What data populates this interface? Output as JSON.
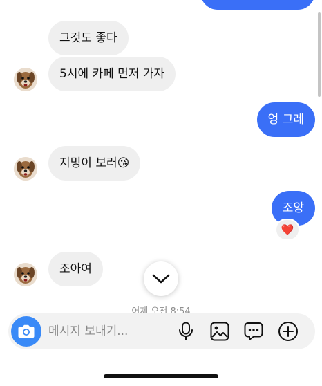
{
  "messages": [
    {
      "text": "그것도 좋다",
      "direction": "incoming"
    },
    {
      "text": "5시에 카페 먼저 가자",
      "direction": "incoming"
    },
    {
      "text": "엉 그레",
      "direction": "outgoing"
    },
    {
      "text": "지밍이 보러",
      "emoji": "😘",
      "direction": "incoming"
    },
    {
      "text": "조앙",
      "direction": "outgoing",
      "reaction": "❤️"
    },
    {
      "text": "조아여",
      "direction": "incoming"
    }
  ],
  "timestamp": "어제 오전 8:54",
  "composer": {
    "placeholder": "메시지 보내기...",
    "icons": [
      "camera-icon",
      "microphone-icon",
      "gallery-icon",
      "sticker-chat-icon",
      "add-icon"
    ]
  },
  "scroll_down_icon": "chevron-down-icon",
  "colors": {
    "outgoing_bubble": "#3a6ff7",
    "incoming_bubble": "#efefef",
    "camera_button": "#3a8af7",
    "timestamp": "#8e8e8e"
  }
}
